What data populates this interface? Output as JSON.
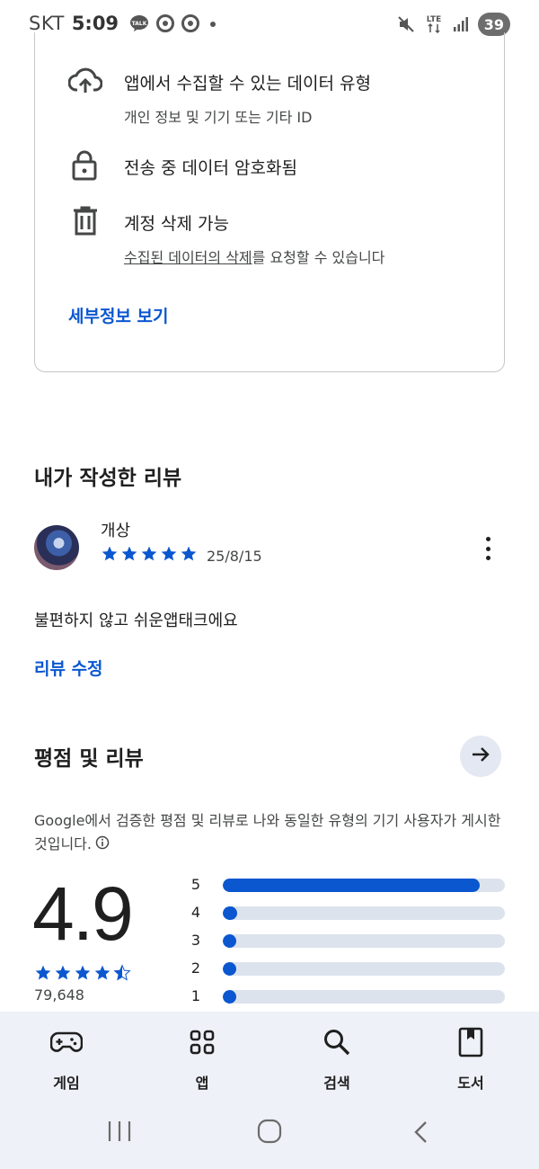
{
  "status_bar": {
    "carrier": "SKT",
    "time": "5:09",
    "notification_icons": [
      "talk-icon",
      "chrome-icon",
      "chrome-icon",
      "dot-icon"
    ],
    "network": "LTE",
    "battery": "39"
  },
  "data_safety": {
    "items": [
      {
        "icon": "cloud-upload-icon",
        "title": "앱에서 수집할 수 있는 데이터 유형",
        "subtitle": "개인 정보 및 기기 또는 기타 ID"
      },
      {
        "icon": "lock-icon",
        "title": "전송 중 데이터 암호화됨",
        "subtitle": ""
      },
      {
        "icon": "trash-icon",
        "title": "계정 삭제 가능",
        "subtitle_link": "수집된 데이터의 삭제",
        "subtitle_rest": "를 요청할 수 있습니다"
      }
    ],
    "details_link": "세부정보 보기"
  },
  "my_review": {
    "section_title": "내가 작성한 리뷰",
    "reviewer_name": "개상",
    "star_rating": 5,
    "date": "25/8/15",
    "text": "불편하지 않고 쉬운앱태크에요",
    "edit_link": "리뷰 수정"
  },
  "ratings": {
    "section_title": "평점 및 리뷰",
    "description": "Google에서 검증한 평점 및 리뷰로 나와 동일한 유형의 기기 사용자가 게시한 것입니다.",
    "average": "4.9",
    "average_stars": 4.5,
    "count": "79,648",
    "distribution": [
      {
        "label": "5",
        "fraction": 0.91
      },
      {
        "label": "4",
        "fraction": 0.05
      },
      {
        "label": "3",
        "fraction": 0.01
      },
      {
        "label": "2",
        "fraction": 0.01
      },
      {
        "label": "1",
        "fraction": 0.01
      }
    ]
  },
  "bottom_nav": {
    "items": [
      {
        "label": "게임",
        "icon": "gamepad-icon"
      },
      {
        "label": "앱",
        "icon": "apps-grid-icon"
      },
      {
        "label": "검색",
        "icon": "search-icon"
      },
      {
        "label": "도서",
        "icon": "book-icon"
      }
    ]
  },
  "colors": {
    "accent": "#0b57d0",
    "bar_track": "#dde3ed",
    "nav_background": "#eef1f7"
  }
}
